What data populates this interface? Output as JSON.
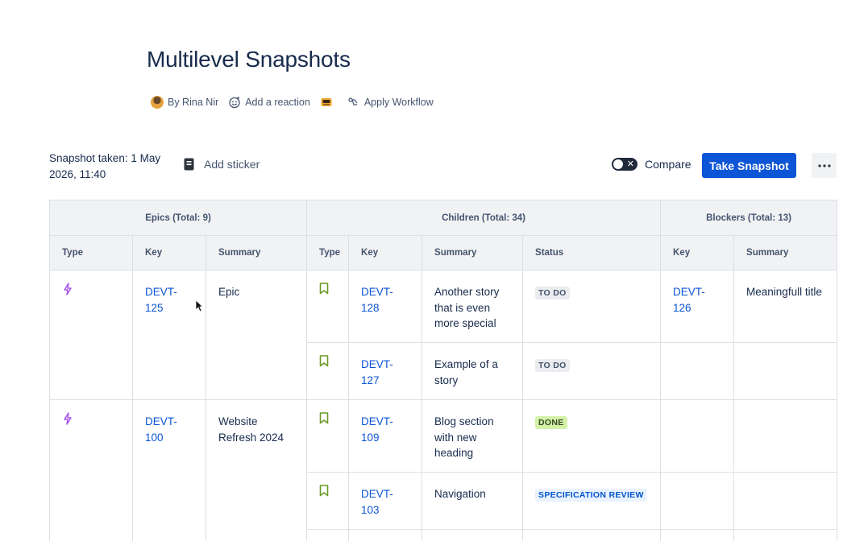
{
  "page": {
    "title": "Multilevel Snapshots",
    "byline": {
      "author": "By Rina Nir",
      "reaction": "Add a reaction",
      "workflow": "Apply Workflow"
    }
  },
  "toolbar": {
    "snapshot_taken": "Snapshot taken: 1 May 2026, 11:40",
    "add_sticker": "Add sticker",
    "compare": "Compare",
    "take_snapshot": "Take Snapshot"
  },
  "table": {
    "groups": {
      "epics": "Epics (Total: 9)",
      "children": "Children (Total: 34)",
      "blockers": "Blockers (Total: 13)"
    },
    "columns": {
      "epic_type": "Type",
      "epic_key": "Key",
      "epic_summary": "Summary",
      "child_type": "Type",
      "child_key": "Key",
      "child_summary": "Summary",
      "child_status": "Status",
      "blocker_key": "Key",
      "blocker_summary": "Summary"
    },
    "epics": [
      {
        "key": "DEVT-125",
        "summary": "Epic",
        "children": [
          {
            "key": "DEVT-128",
            "summary": "Another story that is even more special",
            "status": "TO DO",
            "blocker_key": "DEVT-126",
            "blocker_summary": "Meaningfull title"
          },
          {
            "key": "DEVT-127",
            "summary": "Example of a story",
            "status": "TO DO",
            "blocker_key": "",
            "blocker_summary": ""
          }
        ]
      },
      {
        "key": "DEVT-100",
        "summary": "Website Refresh 2024",
        "children": [
          {
            "key": "DEVT-109",
            "summary": "Blog section with new heading",
            "status": "DONE",
            "blocker_key": "",
            "blocker_summary": ""
          },
          {
            "key": "DEVT-103",
            "summary": "Navigation",
            "status": "SPECIFICATION REVIEW",
            "blocker_key": "",
            "blocker_summary": ""
          }
        ]
      }
    ]
  },
  "icons": {
    "epic": "lightning-icon",
    "story": "bookmark-icon"
  },
  "colors": {
    "primary": "#0c55d6",
    "epic_icon": "#a54ee8",
    "story_icon": "#6a9a23"
  }
}
